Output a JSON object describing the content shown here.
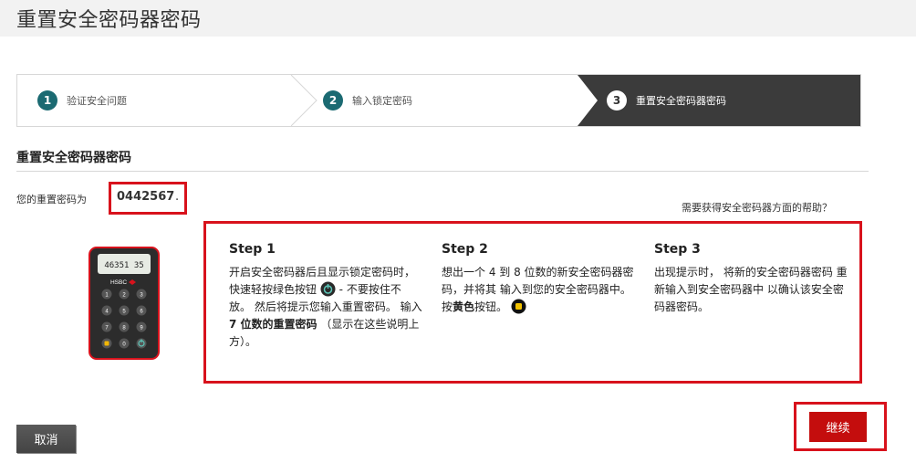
{
  "page": {
    "title": "重置安全密码器密码"
  },
  "stepper": {
    "steps": [
      {
        "number": "1",
        "label": "验证安全问题"
      },
      {
        "number": "2",
        "label": "输入锁定密码"
      },
      {
        "number": "3",
        "label": "重置安全密码器密码"
      }
    ],
    "active_index": 3
  },
  "section": {
    "title": "重置安全密码器密码"
  },
  "reset": {
    "label": "您的重置密码为",
    "code": "0442567",
    "suffix": "."
  },
  "help_link": "需要获得安全密码器方面的帮助？",
  "device": {
    "display": "46351 35",
    "brand": "HSBC",
    "keys": [
      "1",
      "2",
      "3",
      "4",
      "5",
      "6",
      "7",
      "8",
      "9",
      "0"
    ]
  },
  "instructions": {
    "step1": {
      "title": "Step 1",
      "text_a": "开启安全密码器后且显示锁定密码时，快速轻按绿色按钮",
      "text_b": " - 不要按住不放。 然后将提示您输入重置密码。 输入 ",
      "text_bold": "7 位数的重置密码",
      "text_c": " （显示在这些说明上方）。"
    },
    "step2": {
      "title": "Step 2",
      "text_a": "想出一个 4 到 8 位数的新安全密码器密码，并将其 输入到您的安全密码器中。 按",
      "text_bold": "黄色",
      "text_b": "按钮。"
    },
    "step3": {
      "title": "Step 3",
      "text": "出现提示时， 将新的安全密码器密码 重新输入到安全密码器中 以确认该安全密码器密码。"
    }
  },
  "buttons": {
    "cancel": "取消",
    "continue": "继续"
  },
  "colors": {
    "accent_red": "#d8121c",
    "step_teal": "#1b6a72",
    "active_step_bg": "#3b3b3b"
  }
}
